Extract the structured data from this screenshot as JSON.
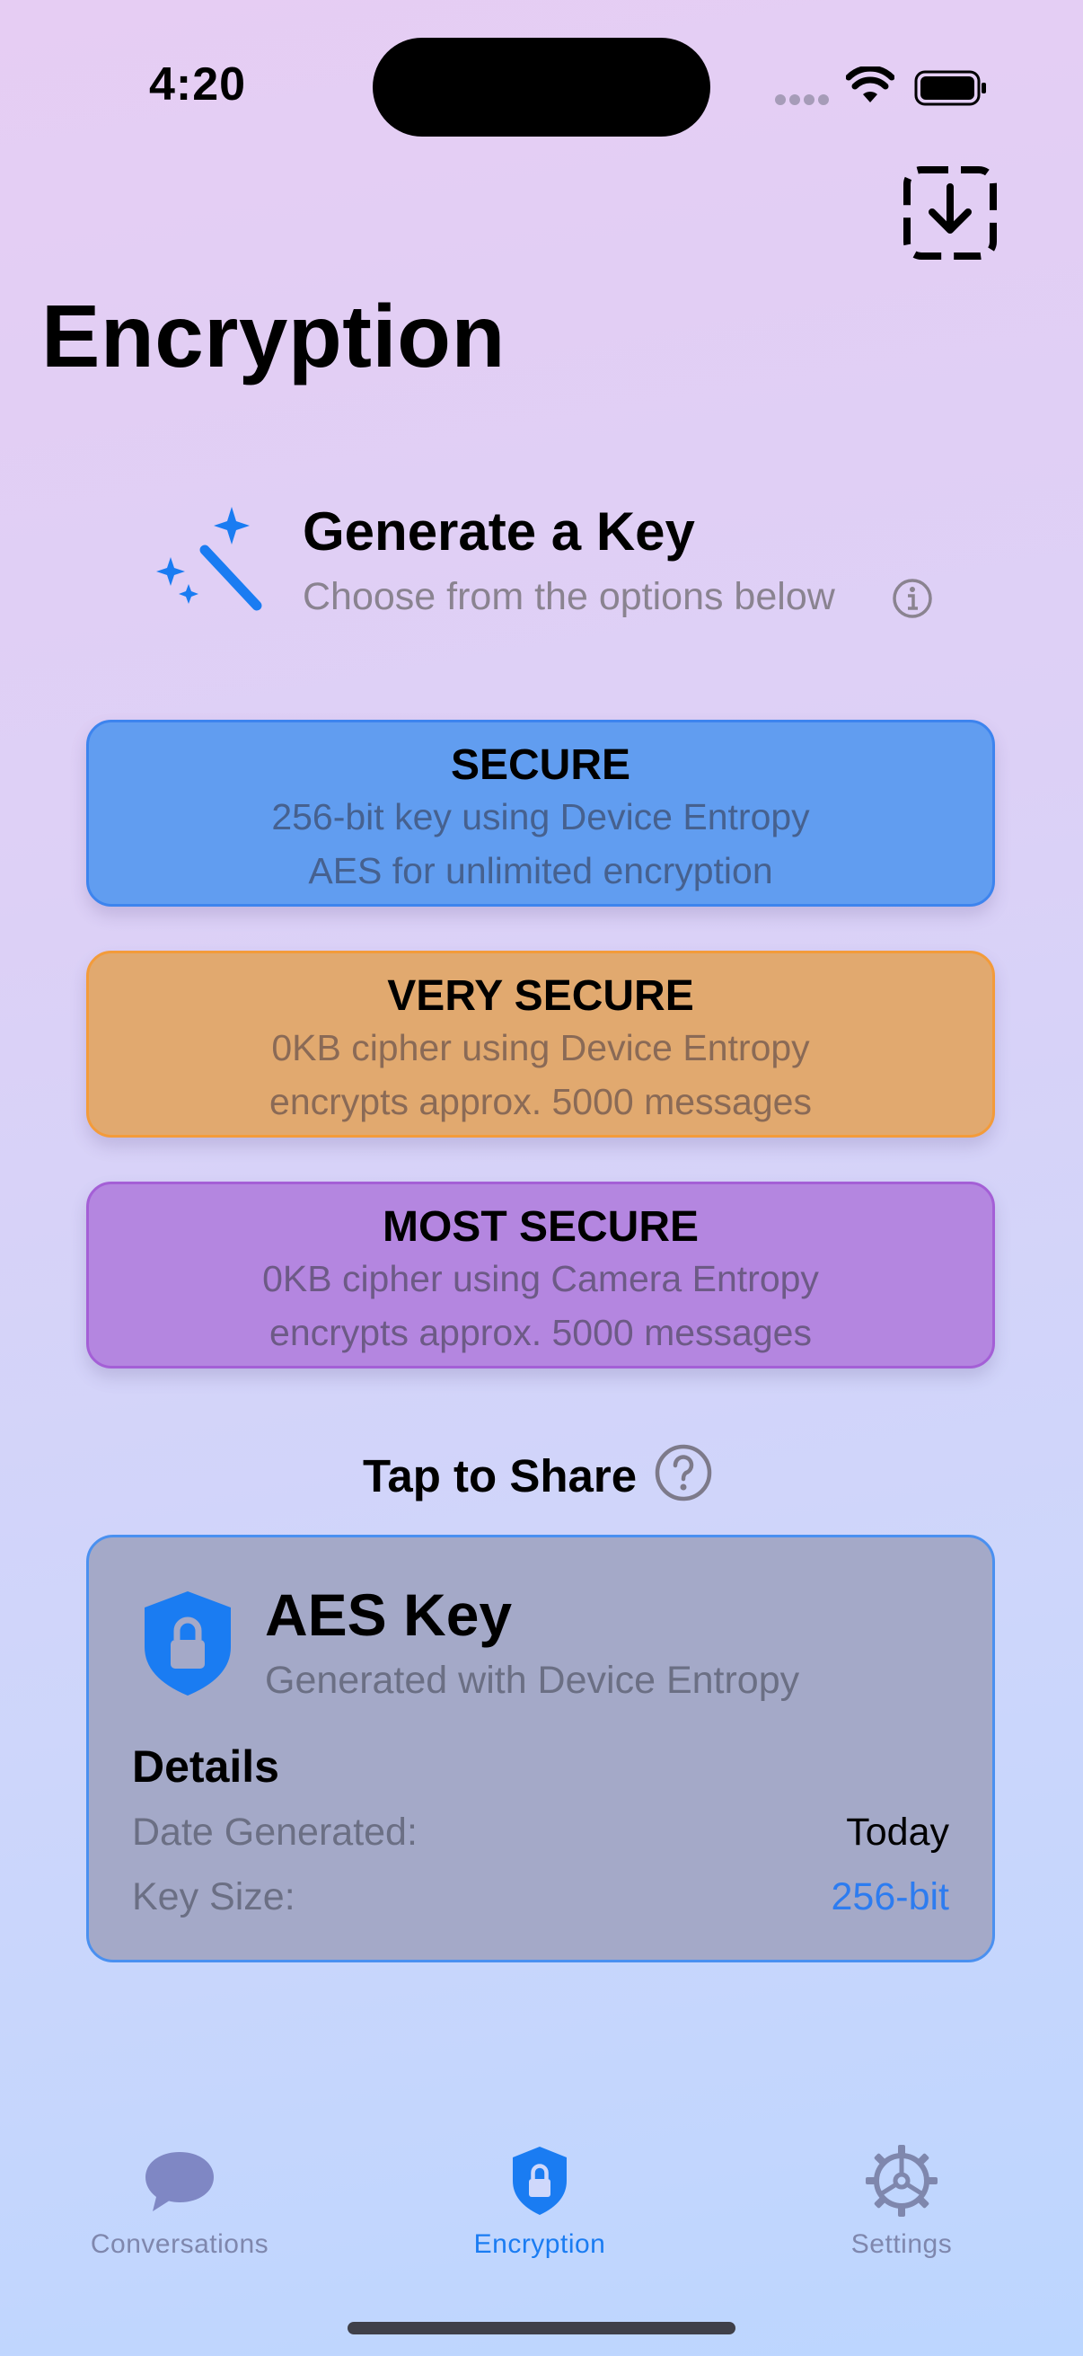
{
  "status_bar": {
    "time": "4:20"
  },
  "header": {
    "title": "Encryption",
    "import_icon": "import-arrow-down-icon"
  },
  "generate": {
    "title": "Generate a Key",
    "subtitle": "Choose from the options below",
    "icon": "magic-wand-sparkles-icon"
  },
  "options": [
    {
      "title": "SECURE",
      "line1": "256-bit key using Device Entropy",
      "line2": "AES for unlimited encryption",
      "color": "#619df0"
    },
    {
      "title": "VERY SECURE",
      "line1": "0KB cipher using Device Entropy",
      "line2": "encrypts approx. 5000 messages",
      "color": "#e1a96f"
    },
    {
      "title": "MOST SECURE",
      "line1": "0KB cipher using Camera Entropy",
      "line2": "encrypts approx. 5000 messages",
      "color": "#b486e0"
    }
  ],
  "share": {
    "label": "Tap to Share"
  },
  "key_card": {
    "title": "AES Key",
    "subtitle": "Generated with Device Entropy",
    "details_heading": "Details",
    "rows": [
      {
        "label": "Date Generated:",
        "value": "Today"
      },
      {
        "label": "Key Size:",
        "value": "256-bit"
      }
    ]
  },
  "tabs": [
    {
      "label": "Conversations",
      "icon": "chat-bubble-icon",
      "active": false
    },
    {
      "label": "Encryption",
      "icon": "lock-shield-icon",
      "active": true
    },
    {
      "label": "Settings",
      "icon": "gear-icon",
      "active": false
    }
  ],
  "colors": {
    "accent": "#1a7cf2",
    "inactive_tab": "#7f87ad"
  }
}
